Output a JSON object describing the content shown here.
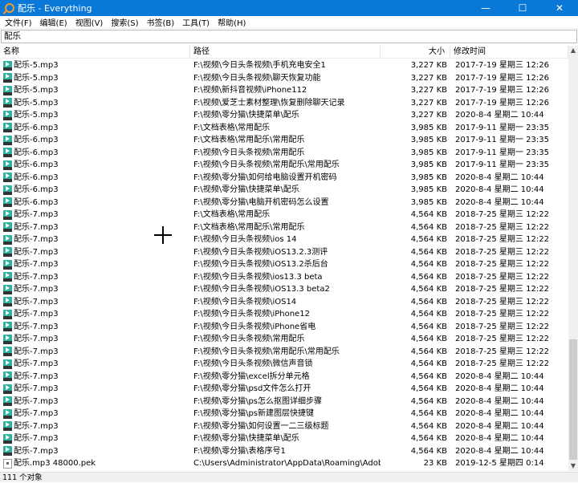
{
  "window": {
    "title": "配乐 - Everything",
    "minimize": "—",
    "maximize": "☐",
    "close": "✕"
  },
  "menu": [
    "文件(F)",
    "编辑(E)",
    "视图(V)",
    "搜索(S)",
    "书签(B)",
    "工具(T)",
    "帮助(H)"
  ],
  "search": {
    "value": "配乐"
  },
  "columns": {
    "name": "名称",
    "path": "路径",
    "size": "大小",
    "date": "修改时间"
  },
  "rows": [
    [
      "配乐-5.mp3",
      "F:\\视频\\今日头条视频\\手机充电安全1",
      "3,227 KB",
      "2017-7-19 星期三 12:26",
      "mp3"
    ],
    [
      "配乐-5.mp3",
      "F:\\视频\\今日头条视频\\聊天恢复功能",
      "3,227 KB",
      "2017-7-19 星期三 12:26",
      "mp3"
    ],
    [
      "配乐-5.mp3",
      "F:\\视频\\新抖音视频\\iPhone112",
      "3,227 KB",
      "2017-7-19 星期三 12:26",
      "mp3"
    ],
    [
      "配乐-5.mp3",
      "F:\\视频\\爱芝士素材整理\\恢复删除聊天记录",
      "3,227 KB",
      "2017-7-19 星期三 12:26",
      "mp3"
    ],
    [
      "配乐-5.mp3",
      "F:\\视频\\零分猫\\快捷菜单\\配乐",
      "3,227 KB",
      "2020-8-4 星期二 10:44",
      "mp3"
    ],
    [
      "配乐-6.mp3",
      "F:\\文档表格\\常用配乐",
      "3,985 KB",
      "2017-9-11 星期一 23:35",
      "mp3"
    ],
    [
      "配乐-6.mp3",
      "F:\\文档表格\\常用配乐\\常用配乐",
      "3,985 KB",
      "2017-9-11 星期一 23:35",
      "mp3"
    ],
    [
      "配乐-6.mp3",
      "F:\\视频\\今日头条视频\\常用配乐",
      "3,985 KB",
      "2017-9-11 星期一 23:35",
      "mp3"
    ],
    [
      "配乐-6.mp3",
      "F:\\视频\\今日头条视频\\常用配乐\\常用配乐",
      "3,985 KB",
      "2017-9-11 星期一 23:35",
      "mp3"
    ],
    [
      "配乐-6.mp3",
      "F:\\视频\\零分猫\\如何给电脑设置开机密码",
      "3,985 KB",
      "2020-8-4 星期二 10:44",
      "mp3"
    ],
    [
      "配乐-6.mp3",
      "F:\\视频\\零分猫\\快捷菜单\\配乐",
      "3,985 KB",
      "2020-8-4 星期二 10:44",
      "mp3"
    ],
    [
      "配乐-6.mp3",
      "F:\\视频\\零分猫\\电脑开机密码怎么设置",
      "3,985 KB",
      "2020-8-4 星期二 10:44",
      "mp3"
    ],
    [
      "配乐-7.mp3",
      "F:\\文档表格\\常用配乐",
      "4,564 KB",
      "2018-7-25 星期三 12:22",
      "mp3"
    ],
    [
      "配乐-7.mp3",
      "F:\\文档表格\\常用配乐\\常用配乐",
      "4,564 KB",
      "2018-7-25 星期三 12:22",
      "mp3"
    ],
    [
      "配乐-7.mp3",
      "F:\\视频\\今日头条视频\\ios 14",
      "4,564 KB",
      "2018-7-25 星期三 12:22",
      "mp3"
    ],
    [
      "配乐-7.mp3",
      "F:\\视频\\今日头条视频\\iOS13.2.3测评",
      "4,564 KB",
      "2018-7-25 星期三 12:22",
      "mp3"
    ],
    [
      "配乐-7.mp3",
      "F:\\视频\\今日头条视频\\iOS13.2杀后台",
      "4,564 KB",
      "2018-7-25 星期三 12:22",
      "mp3"
    ],
    [
      "配乐-7.mp3",
      "F:\\视频\\今日头条视频\\ios13.3 beta",
      "4,564 KB",
      "2018-7-25 星期三 12:22",
      "mp3"
    ],
    [
      "配乐-7.mp3",
      "F:\\视频\\今日头条视频\\iOS13.3 beta2",
      "4,564 KB",
      "2018-7-25 星期三 12:22",
      "mp3"
    ],
    [
      "配乐-7.mp3",
      "F:\\视频\\今日头条视频\\iOS14",
      "4,564 KB",
      "2018-7-25 星期三 12:22",
      "mp3"
    ],
    [
      "配乐-7.mp3",
      "F:\\视频\\今日头条视频\\iPhone12",
      "4,564 KB",
      "2018-7-25 星期三 12:22",
      "mp3"
    ],
    [
      "配乐-7.mp3",
      "F:\\视频\\今日头条视频\\iPhone省电",
      "4,564 KB",
      "2018-7-25 星期三 12:22",
      "mp3"
    ],
    [
      "配乐-7.mp3",
      "F:\\视频\\今日头条视频\\常用配乐",
      "4,564 KB",
      "2018-7-25 星期三 12:22",
      "mp3"
    ],
    [
      "配乐-7.mp3",
      "F:\\视频\\今日头条视频\\常用配乐\\常用配乐",
      "4,564 KB",
      "2018-7-25 星期三 12:22",
      "mp3"
    ],
    [
      "配乐-7.mp3",
      "F:\\视频\\今日头条视频\\微信声音锁",
      "4,564 KB",
      "2018-7-25 星期三 12:22",
      "mp3"
    ],
    [
      "配乐-7.mp3",
      "F:\\视频\\零分猫\\excel拆分单元格",
      "4,564 KB",
      "2020-8-4 星期二 10:44",
      "mp3"
    ],
    [
      "配乐-7.mp3",
      "F:\\视频\\零分猫\\psd文件怎么打开",
      "4,564 KB",
      "2020-8-4 星期二 10:44",
      "mp3"
    ],
    [
      "配乐-7.mp3",
      "F:\\视频\\零分猫\\ps怎么抠图详细步骤",
      "4,564 KB",
      "2020-8-4 星期二 10:44",
      "mp3"
    ],
    [
      "配乐-7.mp3",
      "F:\\视频\\零分猫\\ps新建图层快捷键",
      "4,564 KB",
      "2020-8-4 星期二 10:44",
      "mp3"
    ],
    [
      "配乐-7.mp3",
      "F:\\视频\\零分猫\\如何设置一二三级标题",
      "4,564 KB",
      "2020-8-4 星期二 10:44",
      "mp3"
    ],
    [
      "配乐-7.mp3",
      "F:\\视频\\零分猫\\快捷菜单\\配乐",
      "4,564 KB",
      "2020-8-4 星期二 10:44",
      "mp3"
    ],
    [
      "配乐-7.mp3",
      "F:\\视频\\零分猫\\表格序号1",
      "4,564 KB",
      "2020-8-4 星期二 10:44",
      "mp3"
    ],
    [
      "配乐.mp3 48000.pek",
      "C:\\Users\\Administrator\\AppData\\Roaming\\Adobe\\C...",
      "23 KB",
      "2019-12-5 星期四 0:14",
      "pek"
    ]
  ],
  "status": "111 个对象"
}
